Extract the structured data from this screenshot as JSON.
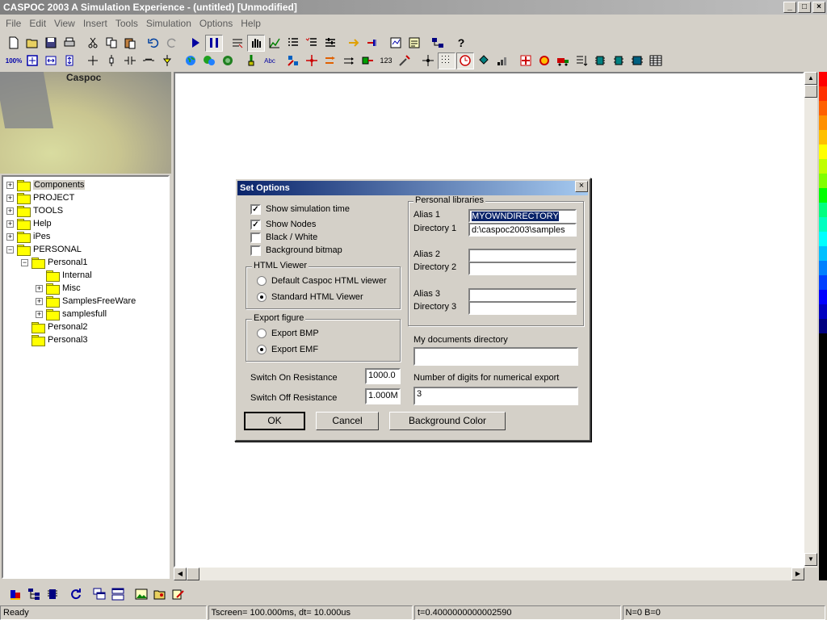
{
  "window": {
    "title": "CASPOC 2003 A Simulation Experience - (untitled) [Unmodified]",
    "buttons": {
      "minimize": "_",
      "maximize": "□",
      "close": "×"
    }
  },
  "menu": [
    "File",
    "Edit",
    "View",
    "Insert",
    "Tools",
    "Simulation",
    "Options",
    "Help"
  ],
  "left_panel": {
    "logo_text": "Caspoc"
  },
  "tree": [
    {
      "label": "Components",
      "expander": "+",
      "selected": true
    },
    {
      "label": "PROJECT",
      "expander": "+"
    },
    {
      "label": "TOOLS",
      "expander": "+"
    },
    {
      "label": "Help",
      "expander": "+"
    },
    {
      "label": "iPes",
      "expander": "+"
    },
    {
      "label": "PERSONAL",
      "expander": "−"
    },
    {
      "label": "Personal1",
      "expander": "−"
    },
    {
      "label": "Internal",
      "expander": ""
    },
    {
      "label": "Misc",
      "expander": "+"
    },
    {
      "label": "SamplesFreeWare",
      "expander": "+"
    },
    {
      "label": "samplesfull",
      "expander": "+"
    },
    {
      "label": "Personal2",
      "expander": ""
    },
    {
      "label": "Personal3",
      "expander": ""
    }
  ],
  "toolbar": {
    "zoom_label": "100%",
    "abc_label": "Abc",
    "num_label": "123",
    "help_label": "?"
  },
  "dialog": {
    "title": "Set Options",
    "close": "×",
    "checkboxes": {
      "show_sim_time": {
        "label": "Show simulation time",
        "checked": true
      },
      "show_nodes": {
        "label": "Show Nodes",
        "checked": true
      },
      "black_white": {
        "label": "Black / White",
        "checked": false
      },
      "bg_bitmap": {
        "label": "Background bitmap",
        "checked": false
      }
    },
    "html_viewer": {
      "label": "HTML Viewer",
      "option_default": "Default Caspoc HTML viewer",
      "option_standard": "Standard HTML Viewer"
    },
    "export_figure": {
      "label": "Export figure",
      "option_bmp": "Export BMP",
      "option_emf": "Export EMF"
    },
    "switch_on": {
      "label": "Switch On Resistance",
      "value": "1000.0"
    },
    "switch_off": {
      "label": "Switch Off Resistance",
      "value": "1.000M"
    },
    "personal_libraries": {
      "label": "Personal libraries",
      "alias1_label": "Alias 1",
      "alias1_value": "MYOWNDIRECTORY",
      "dir1_label": "Directory 1",
      "dir1_value": "d:\\caspoc2003\\samples",
      "alias2_label": "Alias 2",
      "alias2_value": "",
      "dir2_label": "Directory 2",
      "dir2_value": "",
      "alias3_label": "Alias 3",
      "alias3_value": "",
      "dir3_label": "Directory 3",
      "dir3_value": ""
    },
    "my_documents": {
      "label": "My documents directory",
      "value": ""
    },
    "digits": {
      "label": "Number of digits for numerical export",
      "value": "3"
    },
    "buttons": {
      "ok": "OK",
      "cancel": "Cancel",
      "bg_color": "Background Color"
    }
  },
  "status": {
    "ready": "Ready",
    "tscreen": "Tscreen= 100.000ms, dt= 10.000us",
    "time": "t=0.4000000000002590",
    "nodes": "N=0 B=0"
  },
  "colors": {
    "colorbar": [
      "#ff0000",
      "#ff3000",
      "#ff6000",
      "#ff9000",
      "#ffc000",
      "#ffff00",
      "#c0ff00",
      "#80ff00",
      "#00ff00",
      "#00ff80",
      "#00ffc0",
      "#00ffff",
      "#00c0ff",
      "#0080ff",
      "#0040ff",
      "#0000ff",
      "#0000c0",
      "#000080"
    ]
  }
}
